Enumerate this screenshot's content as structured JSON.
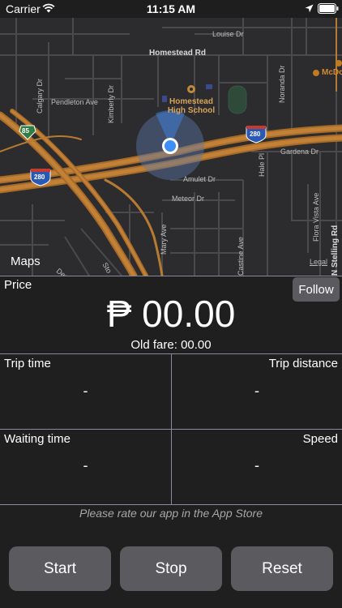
{
  "status_bar": {
    "carrier": "Carrier",
    "time": "11:15 AM"
  },
  "map": {
    "streets": {
      "louise": "Louise Dr",
      "homestead_rd": "Homestead Rd",
      "pendleton": "Pendleton Ave",
      "calgary": "Calgary Dr",
      "kimberly": "Kimberly Dr",
      "noranda": "Noranda Dr",
      "gardena": "Gardena Dr",
      "hale": "Hale Pl",
      "amulet": "Amulet Dr",
      "meteor": "Meteor Dr",
      "mary": "Mary Ave",
      "castine": "Castine Ave",
      "flora_vista": "Flora Vista Ave",
      "n_stelling": "N Stelling Rd",
      "demo": "Demo",
      "sto": "Sto"
    },
    "school_line1": "Homestead",
    "school_line2": "High School",
    "mcdonalds": "McDo",
    "shield_85": "85",
    "shield_280_a": "280",
    "shield_280_b": "280",
    "maps_logo": "Maps",
    "legal": "Legal"
  },
  "price": {
    "label": "Price",
    "follow": "Follow",
    "value": "₱ 00.00",
    "old_fare": "Old fare: 00.00"
  },
  "stats": {
    "trip_time_label": "Trip time",
    "trip_time_value": "-",
    "trip_distance_label": "Trip distance",
    "trip_distance_value": "-",
    "waiting_time_label": "Waiting time",
    "waiting_time_value": "-",
    "speed_label": "Speed",
    "speed_value": "-"
  },
  "rate_prompt": "Please rate our app in the App Store",
  "buttons": {
    "start": "Start",
    "stop": "Stop",
    "reset": "Reset"
  },
  "colors": {
    "background": "#1f1f1f",
    "button": "#5b5b5f",
    "highway": "#b5762f",
    "user_location": "#3e8ef7"
  }
}
